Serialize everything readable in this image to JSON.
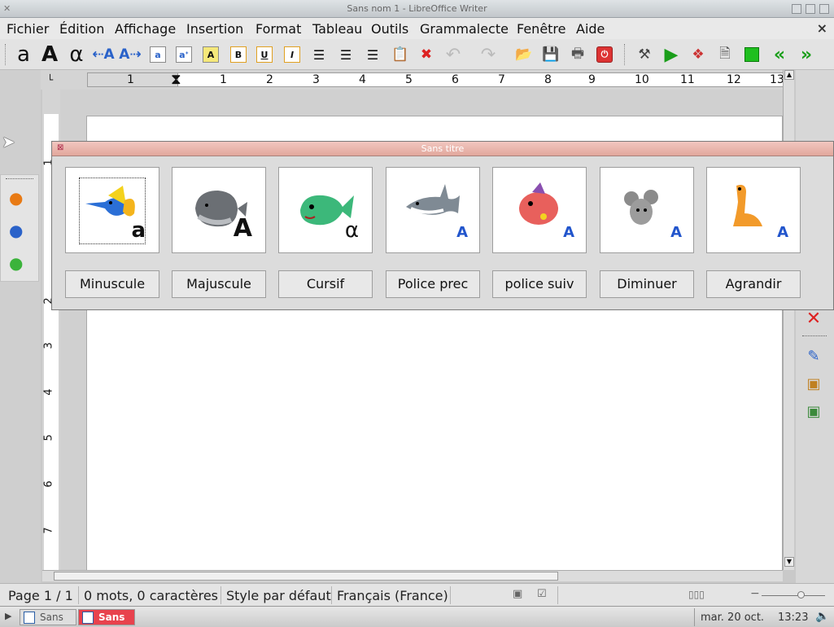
{
  "window": {
    "title": "Sans nom 1 - LibreOffice Writer"
  },
  "menu": {
    "items": [
      "Fichier",
      "Édition",
      "Affichage",
      "Insertion",
      "Format",
      "Tableau",
      "Outils",
      "Grammalecte",
      "Fenêtre",
      "Aide"
    ],
    "close": "×"
  },
  "toolbar": {
    "icons": [
      "lowercase-a-icon",
      "uppercase-a-icon",
      "cursive-a-icon",
      "font-previous-icon",
      "font-next-icon",
      "text-small-icon",
      "text-large-icon",
      "text-highlight-icon",
      "bold-icon",
      "underline-icon",
      "italic-icon",
      "align-left-icon",
      "align-center-icon",
      "align-right-icon",
      "paste-icon",
      "delete-icon",
      "undo-icon",
      "redo-icon",
      "open-icon",
      "save-icon",
      "print-icon",
      "power-icon",
      "tools-icon",
      "play-icon",
      "extensions-icon",
      "document-icon",
      "stop-icon",
      "prev-icon",
      "next-icon"
    ]
  },
  "ruler": {
    "h_numbers": [
      "1",
      "1",
      "2",
      "3",
      "4",
      "5",
      "6",
      "7",
      "8",
      "9",
      "10",
      "11",
      "12",
      "13"
    ],
    "v_numbers": [
      "1",
      "2",
      "3",
      "4",
      "5",
      "6",
      "7"
    ]
  },
  "dialog": {
    "title": "Sans titre",
    "cards": [
      {
        "name": "swordfish",
        "glyph": "a"
      },
      {
        "name": "whale",
        "glyph": "A"
      },
      {
        "name": "fish",
        "glyph": "α"
      },
      {
        "name": "shark",
        "glyph": "A"
      },
      {
        "name": "red-fish",
        "glyph": "A"
      },
      {
        "name": "mouse",
        "glyph": "A"
      },
      {
        "name": "dinosaur",
        "glyph": "A"
      }
    ],
    "buttons": [
      "Minuscule",
      "Majuscule",
      "Cursif",
      "Police prec",
      "police suiv",
      "Diminuer",
      "Agrandir"
    ]
  },
  "status": {
    "page": "Page 1 / 1",
    "words": "0 mots, 0 caractères",
    "style": "Style par défaut",
    "language": "Français (France)"
  },
  "taskbar": {
    "tasks": [
      "Sans",
      "Sans"
    ],
    "date": "mar. 20 oct.",
    "time": "13:23"
  }
}
